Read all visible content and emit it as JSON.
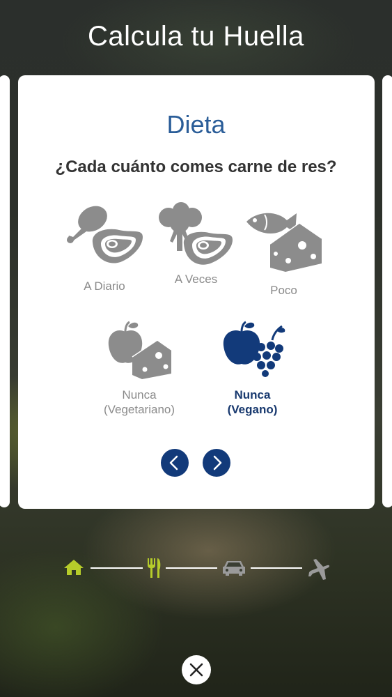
{
  "header": {
    "title": "Calcula tu Huella"
  },
  "card": {
    "title": "Dieta",
    "question": "¿Cada cuánto comes carne de res?",
    "options": [
      {
        "label": "A Diario",
        "icon": "chicken-steak-icon"
      },
      {
        "label": "A Veces",
        "icon": "broccoli-steak-icon"
      },
      {
        "label": "Poco",
        "icon": "fish-cheese-icon"
      },
      {
        "label": "Nunca",
        "label2": "(Vegetariano)",
        "icon": "apple-cheese-icon"
      },
      {
        "label": "Nunca",
        "label2": "(Vegano)",
        "icon": "apple-grapes-icon",
        "selected": true
      }
    ]
  },
  "navigation": {
    "prev": "chevron-left-icon",
    "next": "chevron-right-icon"
  },
  "progress": {
    "steps": [
      "home-icon",
      "fork-knife-icon",
      "car-icon",
      "airplane-icon"
    ],
    "active_color": "#b6cc2a",
    "inactive_color": "#9a9a9a"
  },
  "colors": {
    "accent": "#123a7a",
    "title_blue": "#2a5d98",
    "icon_gray": "#8c8c8c"
  }
}
